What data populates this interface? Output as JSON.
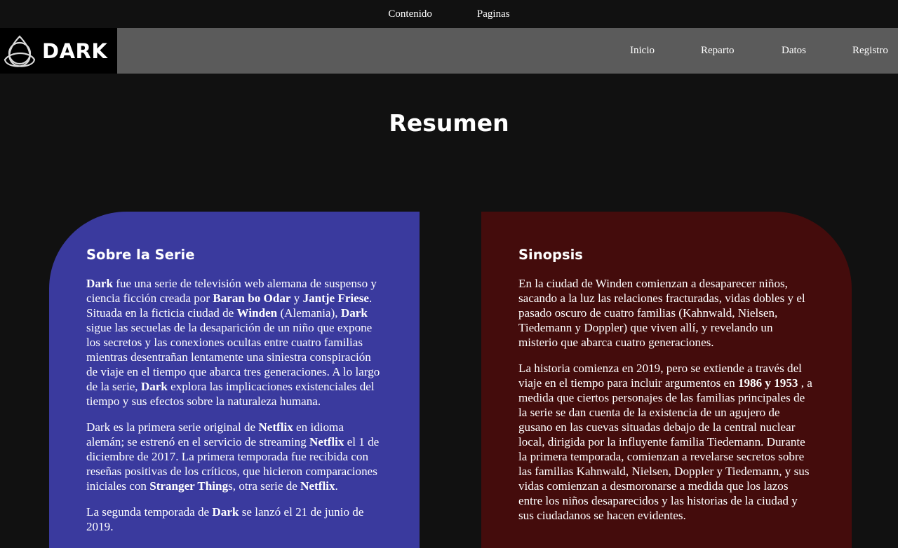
{
  "topbar": {
    "links": [
      "Contenido",
      "Paginas"
    ]
  },
  "navbar": {
    "logo_text": "DARK",
    "items": [
      "Inicio",
      "Reparto",
      "Datos",
      "Registro"
    ]
  },
  "page_title": "Resumen",
  "colors": {
    "background": "#111111",
    "navbar": "#5b5b5b",
    "card_left": "#3a3a9e",
    "card_right": "#440c0c"
  },
  "about": {
    "heading": "Sobre la Serie",
    "p1": [
      {
        "t": "Dark",
        "b": true
      },
      {
        "t": " fue una serie de televisión web alemana de suspenso y ciencia ficción creada por "
      },
      {
        "t": "Baran bo Odar",
        "b": true
      },
      {
        "t": " y "
      },
      {
        "t": "Jantje Friese",
        "b": true
      },
      {
        "t": ". Situada en la ficticia ciudad de "
      },
      {
        "t": "Winden",
        "b": true
      },
      {
        "t": " (Alemania), "
      },
      {
        "t": "Dark",
        "b": true
      },
      {
        "t": " sigue las secuelas de la desaparición de un niño que expone los secretos y las conexiones ocultas entre cuatro familias mientras desentrañan lentamente una siniestra conspiración de viaje en el tiempo que abarca tres generaciones. A lo largo de la serie, "
      },
      {
        "t": "Dark",
        "b": true
      },
      {
        "t": " explora las implicaciones existenciales del tiempo y sus efectos sobre la naturaleza humana."
      }
    ],
    "p2": [
      {
        "t": "Dark es la primera serie original de "
      },
      {
        "t": "Netflix",
        "b": true
      },
      {
        "t": " en idioma alemán; se estrenó en el servicio de streaming "
      },
      {
        "t": "Netflix",
        "b": true
      },
      {
        "t": " el 1 de diciembre de 2017. La primera temporada fue recibida con reseñas positivas de los críticos, que hicieron comparaciones iniciales con "
      },
      {
        "t": "Stranger Thing",
        "b": true
      },
      {
        "t": "s, otra serie de "
      },
      {
        "t": "Netflix",
        "b": true
      },
      {
        "t": "."
      }
    ],
    "p3": [
      {
        "t": "La segunda temporada de "
      },
      {
        "t": "Dark",
        "b": true
      },
      {
        "t": " se lanzó el 21 de junio de 2019."
      }
    ]
  },
  "synopsis": {
    "heading": "Sinopsis",
    "p1": [
      {
        "t": "En la ciudad de Winden comienzan a desaparecer niños, sacando a la luz las relaciones fracturadas, vidas dobles y el pasado oscuro de cuatro familias (Kahnwald, Nielsen, Tiedemann y Doppler) que viven allí, y revelando un misterio que abarca cuatro generaciones."
      }
    ],
    "p2": [
      {
        "t": "La historia comienza en 2019, pero se extiende a través del viaje en el tiempo para incluir argumentos en "
      },
      {
        "t": "1986 y 1953",
        "b": true
      },
      {
        "t": " , a medida que ciertos personajes de las familias principales de la serie se dan cuenta de la existencia de un agujero de gusano en las cuevas situadas debajo de la central nuclear local, dirigida por la influyente familia Tiedemann. Durante la primera temporada, comienzan a revelarse secretos sobre las familias Kahnwald, Nielsen, Doppler y Tiedemann, y sus vidas comienzan a desmoronarse a medida que los lazos entre los niños desaparecidos y las historias de la ciudad y sus ciudadanos se hacen evidentes."
      }
    ]
  }
}
